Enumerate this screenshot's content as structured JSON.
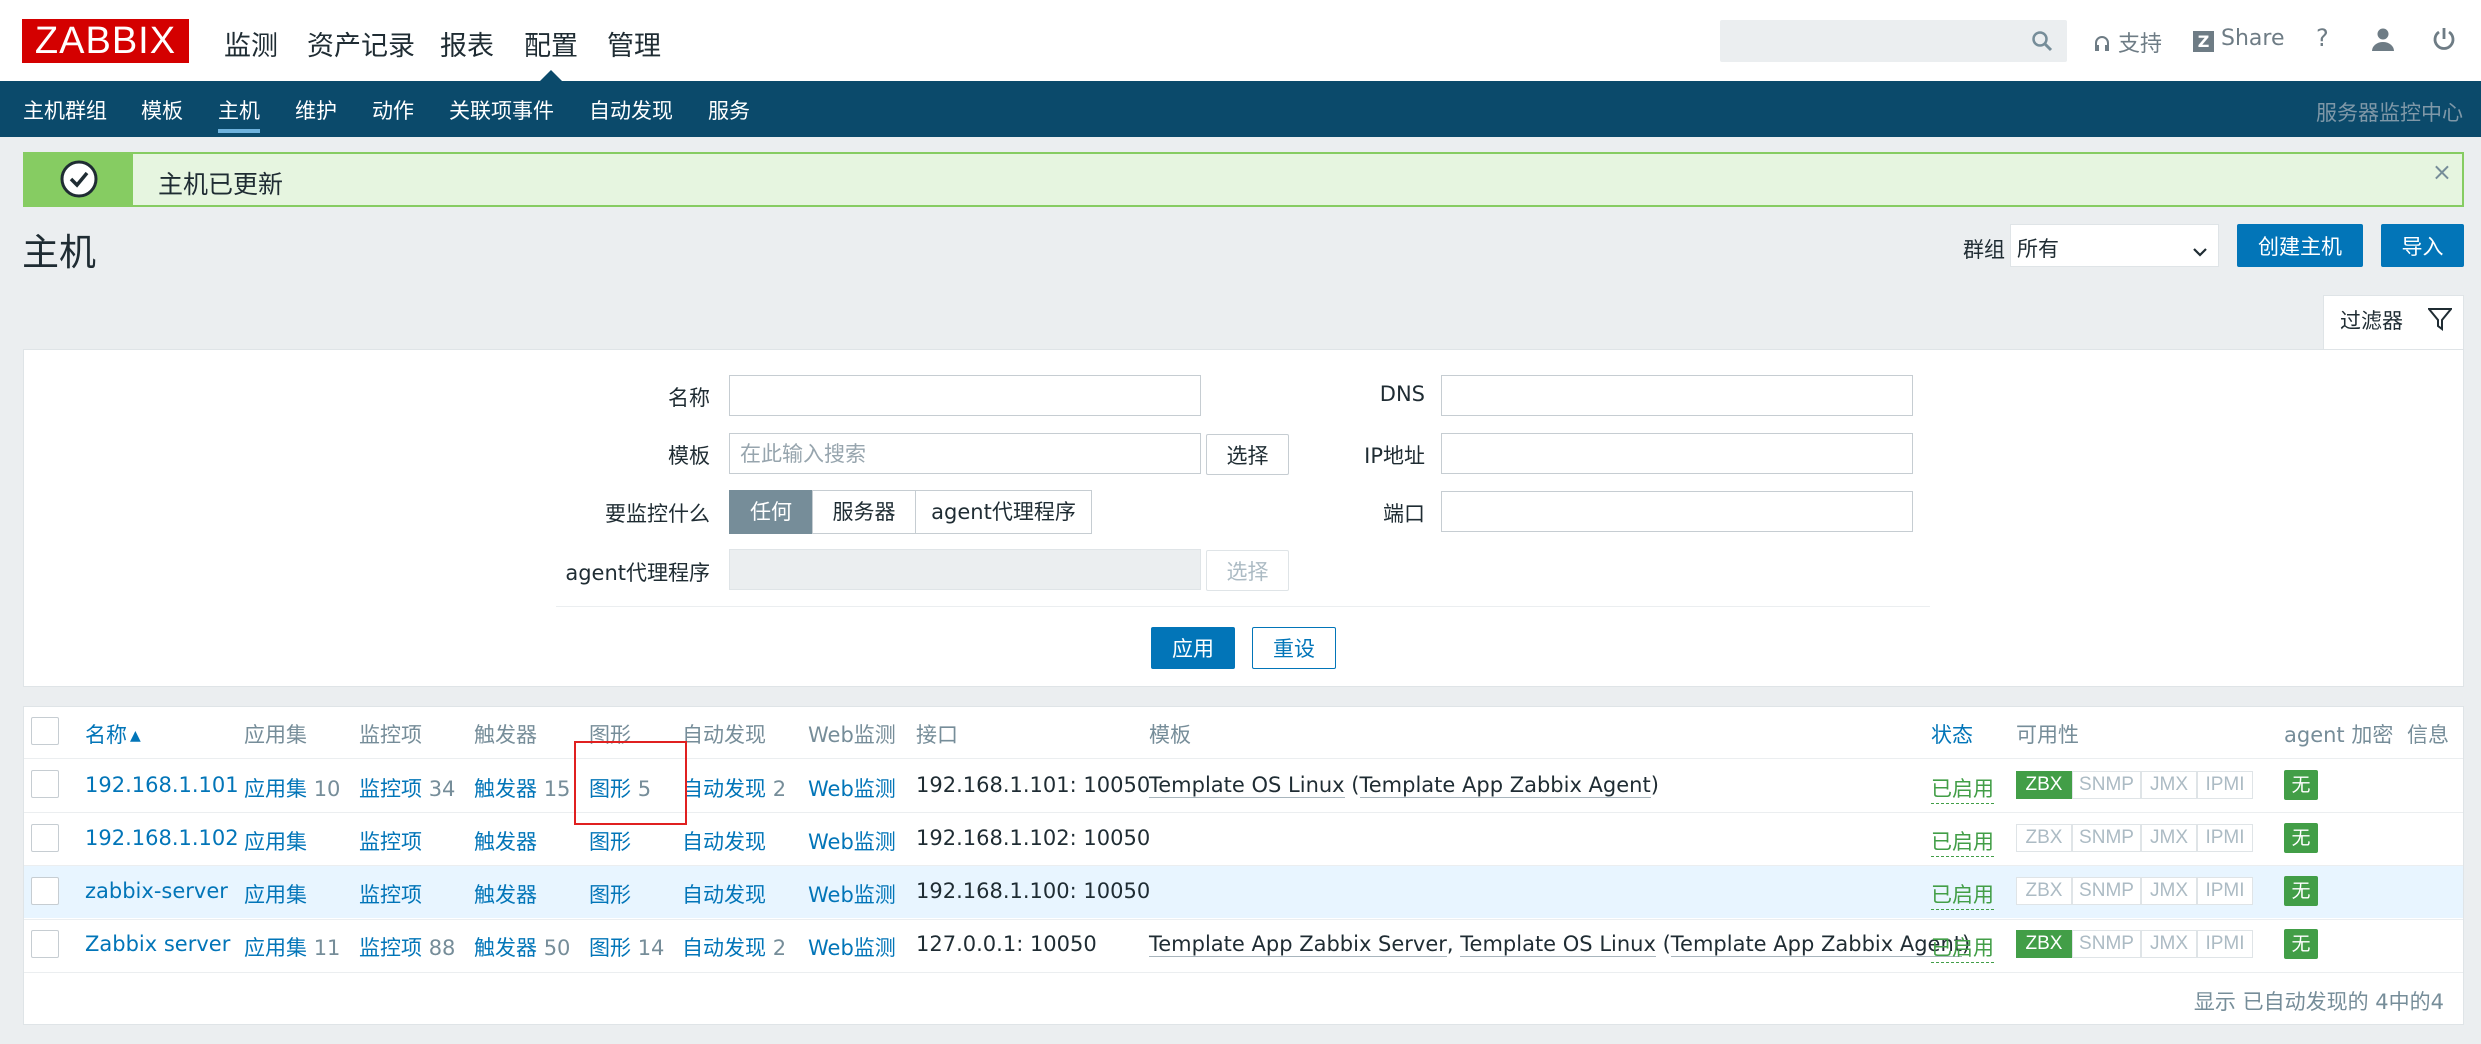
{
  "logo": "ZABBIX",
  "main_nav": [
    "监测",
    "资产记录",
    "报表",
    "配置",
    "管理"
  ],
  "top_right": {
    "support": "支持",
    "share": "Share",
    "help": "?"
  },
  "sub_nav": [
    "主机群组",
    "模板",
    "主机",
    "维护",
    "动作",
    "关联项事件",
    "自动发现",
    "服务"
  ],
  "sub_nav_right": "服务器监控中心",
  "message": "主机已更新",
  "page_title": "主机",
  "group": {
    "label": "群组",
    "value": "所有"
  },
  "buttons": {
    "create": "创建主机",
    "import": "导入",
    "select": "选择",
    "apply": "应用",
    "reset": "重设"
  },
  "filter": {
    "tab_label": "过滤器",
    "name_label": "名称",
    "template_label": "模板",
    "template_placeholder": "在此输入搜索",
    "monitor_label": "要监控什么",
    "monitor_options": [
      "任何",
      "服务器",
      "agent代理程序"
    ],
    "agent_label": "agent代理程序",
    "dns_label": "DNS",
    "ip_label": "IP地址",
    "port_label": "端口"
  },
  "table": {
    "headers": {
      "name": "名称",
      "sort_arrow": "▲",
      "apps": "应用集",
      "items": "监控项",
      "triggers": "触发器",
      "graphs": "图形",
      "discovery": "自动发现",
      "web": "Web监测",
      "interface": "接口",
      "templates": "模板",
      "status": "状态",
      "availability": "可用性",
      "encryption": "agent 加密",
      "info": "信息"
    },
    "rows": [
      {
        "name": "192.168.1.101",
        "apps": "应用集",
        "apps_count": "10",
        "items": "监控项",
        "items_count": "34",
        "triggers": "触发器",
        "triggers_count": "15",
        "graphs": "图形",
        "graphs_count": "5",
        "discovery": "自动发现",
        "discovery_count": "2",
        "web": "Web监测",
        "interface": "192.168.1.101: 10050",
        "tpl1": "Template OS Linux",
        "tpl_sep": " (",
        "tpl2": "Template App Zabbix Agent",
        "tpl_end": ")",
        "status": "已启用",
        "zbx_on": true,
        "enc": "无"
      },
      {
        "name": "192.168.1.102",
        "apps": "应用集",
        "apps_count": "",
        "items": "监控项",
        "items_count": "",
        "triggers": "触发器",
        "triggers_count": "",
        "graphs": "图形",
        "graphs_count": "",
        "discovery": "自动发现",
        "discovery_count": "",
        "web": "Web监测",
        "interface": "192.168.1.102: 10050",
        "status": "已启用",
        "zbx_on": false,
        "enc": "无"
      },
      {
        "name": "zabbix-server",
        "apps": "应用集",
        "apps_count": "",
        "items": "监控项",
        "items_count": "",
        "triggers": "触发器",
        "triggers_count": "",
        "graphs": "图形",
        "graphs_count": "",
        "discovery": "自动发现",
        "discovery_count": "",
        "web": "Web监测",
        "interface": "192.168.1.100: 10050",
        "status": "已启用",
        "zbx_on": false,
        "enc": "无"
      },
      {
        "name": "Zabbix server",
        "apps": "应用集",
        "apps_count": "11",
        "items": "监控项",
        "items_count": "88",
        "triggers": "触发器",
        "triggers_count": "50",
        "graphs": "图形",
        "graphs_count": "14",
        "discovery": "自动发现",
        "discovery_count": "2",
        "web": "Web监测",
        "interface": "127.0.0.1: 10050",
        "tpl1": "Template App Zabbix Server",
        "tpl_sep": ", ",
        "tpl2": "Template OS Linux",
        "tpl_sep2": " (",
        "tpl3": "Template App Zabbix Agent",
        "tpl_end": ")",
        "status": "已启用",
        "zbx_on": true,
        "enc": "无"
      }
    ],
    "avail_labels": [
      "ZBX",
      "SNMP",
      "JMX",
      "IPMI"
    ]
  },
  "footer": "显示 已自动发现的 4中的4",
  "colors": {
    "brand": "#d40000",
    "nav": "#0b4a6b",
    "link": "#0275b8",
    "success": "#429e47",
    "highlight": "#e02020"
  }
}
